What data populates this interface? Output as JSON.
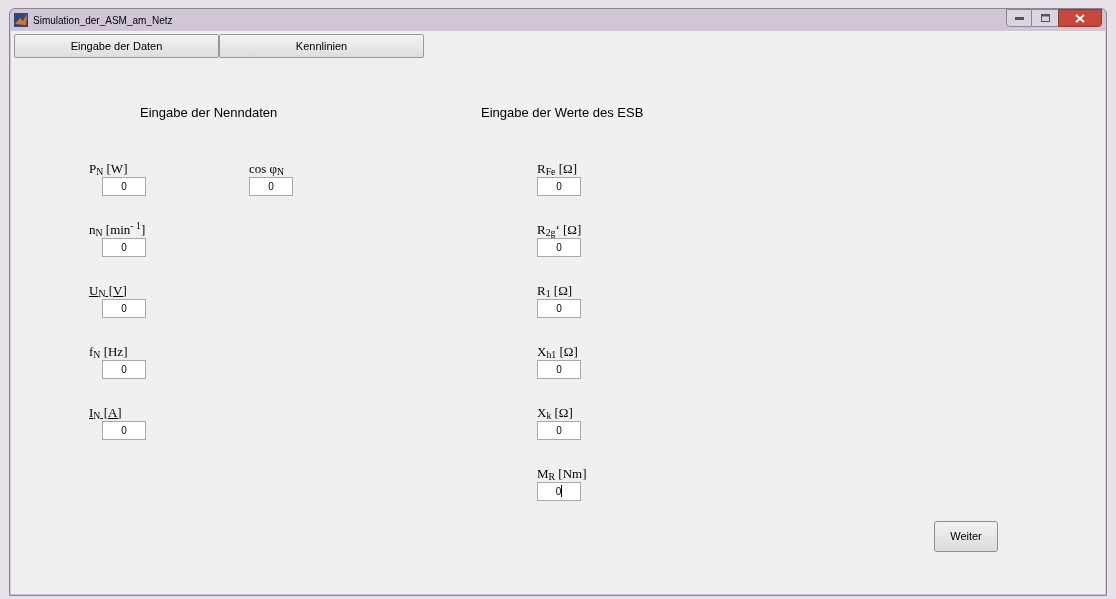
{
  "window": {
    "title": "Simulation_der_ASM_am_Netz"
  },
  "tabs": [
    {
      "label": "Eingabe der Daten",
      "selected": false
    },
    {
      "label": "Kennlinien",
      "selected": false
    }
  ],
  "nenndaten": {
    "heading": "Eingabe der Nenndaten",
    "fields": [
      {
        "label": "P$_{N}$ [W]",
        "value": "0",
        "underlined": false
      },
      {
        "label": "n$_{N}$ [min$^{- 1}$]",
        "value": "0",
        "underlined": false
      },
      {
        "label": "U$_{N}$ [V]",
        "value": "0",
        "underlined": true
      },
      {
        "label": "f$_{N}$ [Hz]",
        "value": "0",
        "underlined": false
      },
      {
        "label": "I$_{N}$ [A]",
        "value": "0",
        "underlined": true
      }
    ],
    "cos_phi": {
      "label": "cos φ$_{N}$",
      "value": "0"
    }
  },
  "esb": {
    "heading": "Eingabe der Werte des ESB",
    "fields": [
      {
        "label": "R$_{Fe}$ [Ω]",
        "value": "0",
        "focused": false
      },
      {
        "label": "R$_{2g}$‘ [Ω]",
        "value": "0",
        "focused": false
      },
      {
        "label": "R$_{1}$ [Ω]",
        "value": "0",
        "focused": false
      },
      {
        "label": "X$_{h1}$ [Ω]",
        "value": "0",
        "focused": false
      },
      {
        "label": "X$_{k}$ [Ω]",
        "value": "0",
        "focused": false
      },
      {
        "label": "M$_{R}$ [Nm]",
        "value": "0",
        "focused": true
      }
    ]
  },
  "button": "Weiter"
}
